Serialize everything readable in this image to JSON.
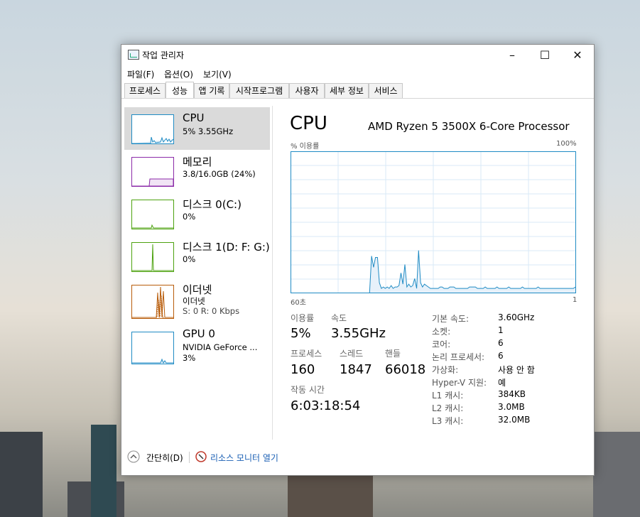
{
  "window": {
    "title": "작업 관리자",
    "controls": {
      "minimize": "–",
      "maximize": "☐",
      "close": "✕"
    }
  },
  "menu": [
    "파일(F)",
    "옵션(O)",
    "보기(V)"
  ],
  "tabs": [
    "프로세스",
    "성능",
    "앱 기록",
    "시작프로그램",
    "사용자",
    "세부 정보",
    "서비스"
  ],
  "active_tab": "성능",
  "sidebar": {
    "items": [
      {
        "title": "CPU",
        "sub1": "5% 3.55GHz",
        "sub2": "",
        "color": "#1f8bc4"
      },
      {
        "title": "메모리",
        "sub1": "3.8/16.0GB (24%)",
        "sub2": "",
        "color": "#8b2aa8"
      },
      {
        "title": "디스크 0(C:)",
        "sub1": "0%",
        "sub2": "",
        "color": "#4da20f"
      },
      {
        "title": "디스크 1(D: F: G:)",
        "sub1": "0%",
        "sub2": "",
        "color": "#4da20f"
      },
      {
        "title": "이더넷",
        "sub1": "이더넷",
        "sub2": "S: 0  R: 0 Kbps",
        "color": "#b85c0a"
      },
      {
        "title": "GPU 0",
        "sub1": "NVIDIA GeForce ...",
        "sub2": "3%",
        "color": "#1f8bc4"
      }
    ]
  },
  "cpu": {
    "title": "CPU",
    "model": "AMD Ryzen 5 3500X 6-Core Processor",
    "graph_ylabel": "% 이용률",
    "graph_ymax_label": "100%",
    "graph_xstart_label": "60초",
    "graph_xend_label": "1",
    "graph_series": [
      0,
      0,
      0,
      0,
      0,
      0,
      0,
      0,
      0,
      0,
      0,
      0,
      0,
      0,
      0,
      0,
      0,
      0,
      0,
      0,
      0,
      0,
      0,
      0,
      0,
      0,
      0,
      0,
      0,
      0,
      0,
      0,
      0,
      0,
      0,
      0,
      0,
      0,
      0,
      0,
      0,
      26,
      18,
      25,
      25,
      7,
      3,
      4,
      3,
      4,
      3,
      5,
      3,
      4,
      4,
      5,
      14,
      6,
      20,
      4,
      6,
      4,
      5,
      10,
      3,
      30,
      7,
      4,
      6,
      5,
      4,
      3,
      3,
      3,
      3,
      3,
      4,
      4,
      3,
      3,
      3,
      4,
      4,
      4,
      3,
      3,
      3,
      3,
      3,
      3,
      3,
      4,
      4,
      4,
      4,
      3,
      3,
      3,
      3,
      4,
      3,
      3,
      3,
      3,
      3,
      4,
      3,
      3,
      3,
      3,
      3,
      4,
      3,
      3,
      3,
      3,
      3,
      3,
      4,
      3,
      3,
      3,
      3,
      3,
      3,
      3,
      4,
      3,
      3,
      3,
      3,
      3,
      3,
      3,
      3,
      3,
      3,
      3,
      3,
      3,
      3,
      3,
      3,
      3,
      3,
      4
    ],
    "stats": {
      "utilization_label": "이용률",
      "utilization": "5%",
      "speed_label": "속도",
      "speed": "3.55GHz",
      "processes_label": "프로세스",
      "processes": "160",
      "threads_label": "스레드",
      "threads": "1847",
      "handles_label": "핸들",
      "handles": "66018",
      "uptime_label": "작동 시간",
      "uptime": "6:03:18:54"
    },
    "specs": [
      {
        "k": "기본 속도:",
        "v": "3.60GHz"
      },
      {
        "k": "소켓:",
        "v": "1"
      },
      {
        "k": "코어:",
        "v": "6"
      },
      {
        "k": "논리 프로세서:",
        "v": "6"
      },
      {
        "k": "가상화:",
        "v": "사용 안 함"
      },
      {
        "k": "Hyper-V 지원:",
        "v": "예"
      },
      {
        "k": "L1 캐시:",
        "v": "384KB"
      },
      {
        "k": "L2 캐시:",
        "v": "3.0MB"
      },
      {
        "k": "L3 캐시:",
        "v": "32.0MB"
      }
    ]
  },
  "footer": {
    "collapse_label": "간단히(D)",
    "resource_monitor_label": "리소스 모니터 열기"
  }
}
